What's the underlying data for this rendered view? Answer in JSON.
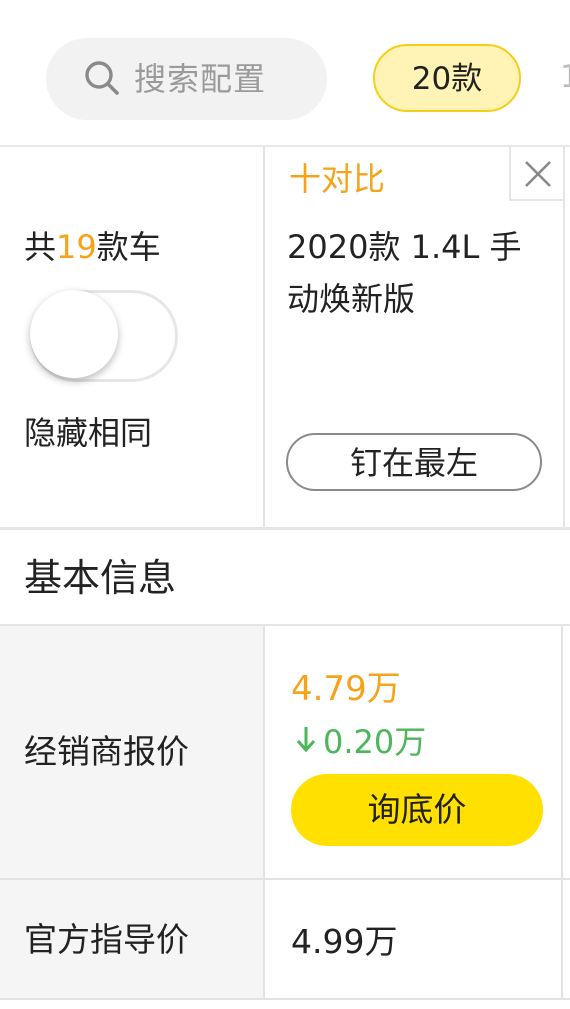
{
  "search": {
    "placeholder": "搜索配置",
    "icon": "search-icon"
  },
  "year_tabs": {
    "active": "20款",
    "next_partial": "1"
  },
  "summary": {
    "prefix": "共",
    "count": "19",
    "suffix": "款车",
    "hide_same_label": "隐藏相同",
    "hide_same_on": false
  },
  "car": {
    "compare_label": "十对比",
    "name": "2020款 1.4L 手动焕新版",
    "pin_label": "钉在最左"
  },
  "section_title": "基本信息",
  "rows": {
    "dealer": {
      "label": "经销商报价",
      "price": "4.79万",
      "drop": "0.20万",
      "ask_label": "询底价"
    },
    "official": {
      "label": "官方指导价",
      "price": "4.99万"
    }
  },
  "colors": {
    "accent_orange": "#f5a31b",
    "drop_green": "#4cb65a",
    "button_yellow": "#ffe000",
    "chip_bg": "#fff4b5"
  }
}
